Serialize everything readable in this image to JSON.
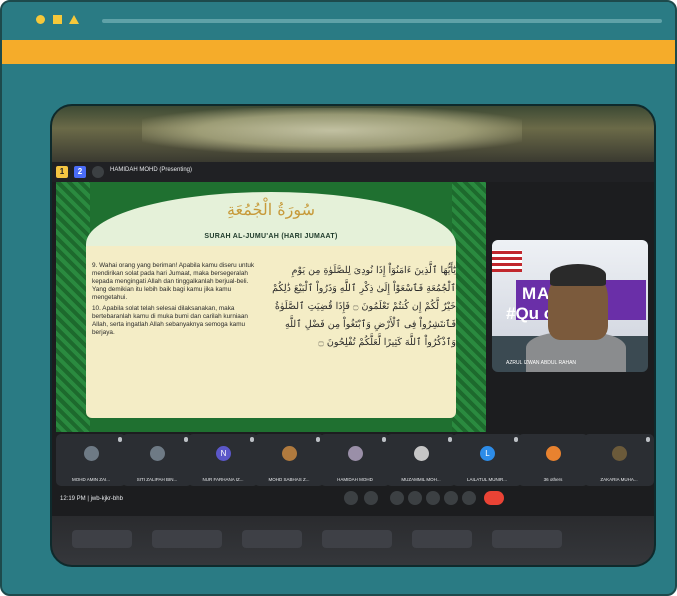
{
  "window": {
    "accent": "#f5ac2a",
    "frame_color": "#2a7b84"
  },
  "meet": {
    "presenting_label": "HAMIDAH MOHD (Presenting)",
    "time_and_code": "12:19 PM | jwb-kjkr-bhb"
  },
  "slide": {
    "arabic_title": "سُورَةُ الْجُمُعَةِ",
    "surah_label": "SURAH AL-JUMU'AH (HARI JUMAAT)",
    "verse_9": "9. Wahai orang yang beriman! Apabila kamu diseru untuk mendirikan solat pada hari Jumaat, maka bersegeralah kepada mengingati Allah dan tinggalkanlah berjual-beli. Yang demikian itu lebih baik bagi kamu jika kamu mengetahui.",
    "verse_10": "10. Apabila solat telah selesai dilaksanakan, maka bertebaranlah kamu di muka bumi dan carilah kurniaan Allah, serta ingatlah Allah sebanyaknya semoga kamu berjaya.",
    "arabic_text": "يَٰٓأَيُّهَا ٱلَّذِينَ ءَامَنُوٓاْ إِذَا نُودِىَ لِلصَّلَوٰةِ مِن يَوْمِ ٱلْجُمُعَةِ فَٱسْعَوْاْ إِلَىٰ ذِكْرِ ٱللَّهِ وَذَرُواْ ٱلْبَيْعَ ذَٰلِكُمْ خَيْرٌ لَّكُمْ إِن كُنتُمْ تَعْلَمُونَ ۝ فَإِذَا قُضِيَتِ ٱلصَّلَوٰةُ فَٱنتَشِرُواْ فِى ٱلْأَرْضِ وَٱبْتَغُواْ مِن فَضْلِ ٱللَّهِ وَٱذْكُرُواْ ٱللَّهَ كَثِيرًا لَّعَلَّكُمْ تُفْلِحُونَ ۝"
  },
  "camera": {
    "banner_line1": "MA    IA",
    "banner_line2": "#Qu    our",
    "speaker_name": "AZRUL IZWAN ABDUL RAHAN"
  },
  "participants": [
    {
      "name": "MOHD AMIN ZAI...",
      "initial": ""
    },
    {
      "name": "SITI ZALIPAH BIN...",
      "initial": ""
    },
    {
      "name": "NUR FARHANA IZ...",
      "initial": "N"
    },
    {
      "name": "MOHD SABHAS Z...",
      "initial": ""
    },
    {
      "name": "HAMIDAH MOHD",
      "initial": ""
    },
    {
      "name": "MUZAMMIL MOH...",
      "initial": ""
    },
    {
      "name": "LAILATUL MUNIR...",
      "initial": "L"
    },
    {
      "name": "36 others",
      "initial": ""
    },
    {
      "name": "ZAKARIA MUHA...",
      "initial": ""
    }
  ]
}
